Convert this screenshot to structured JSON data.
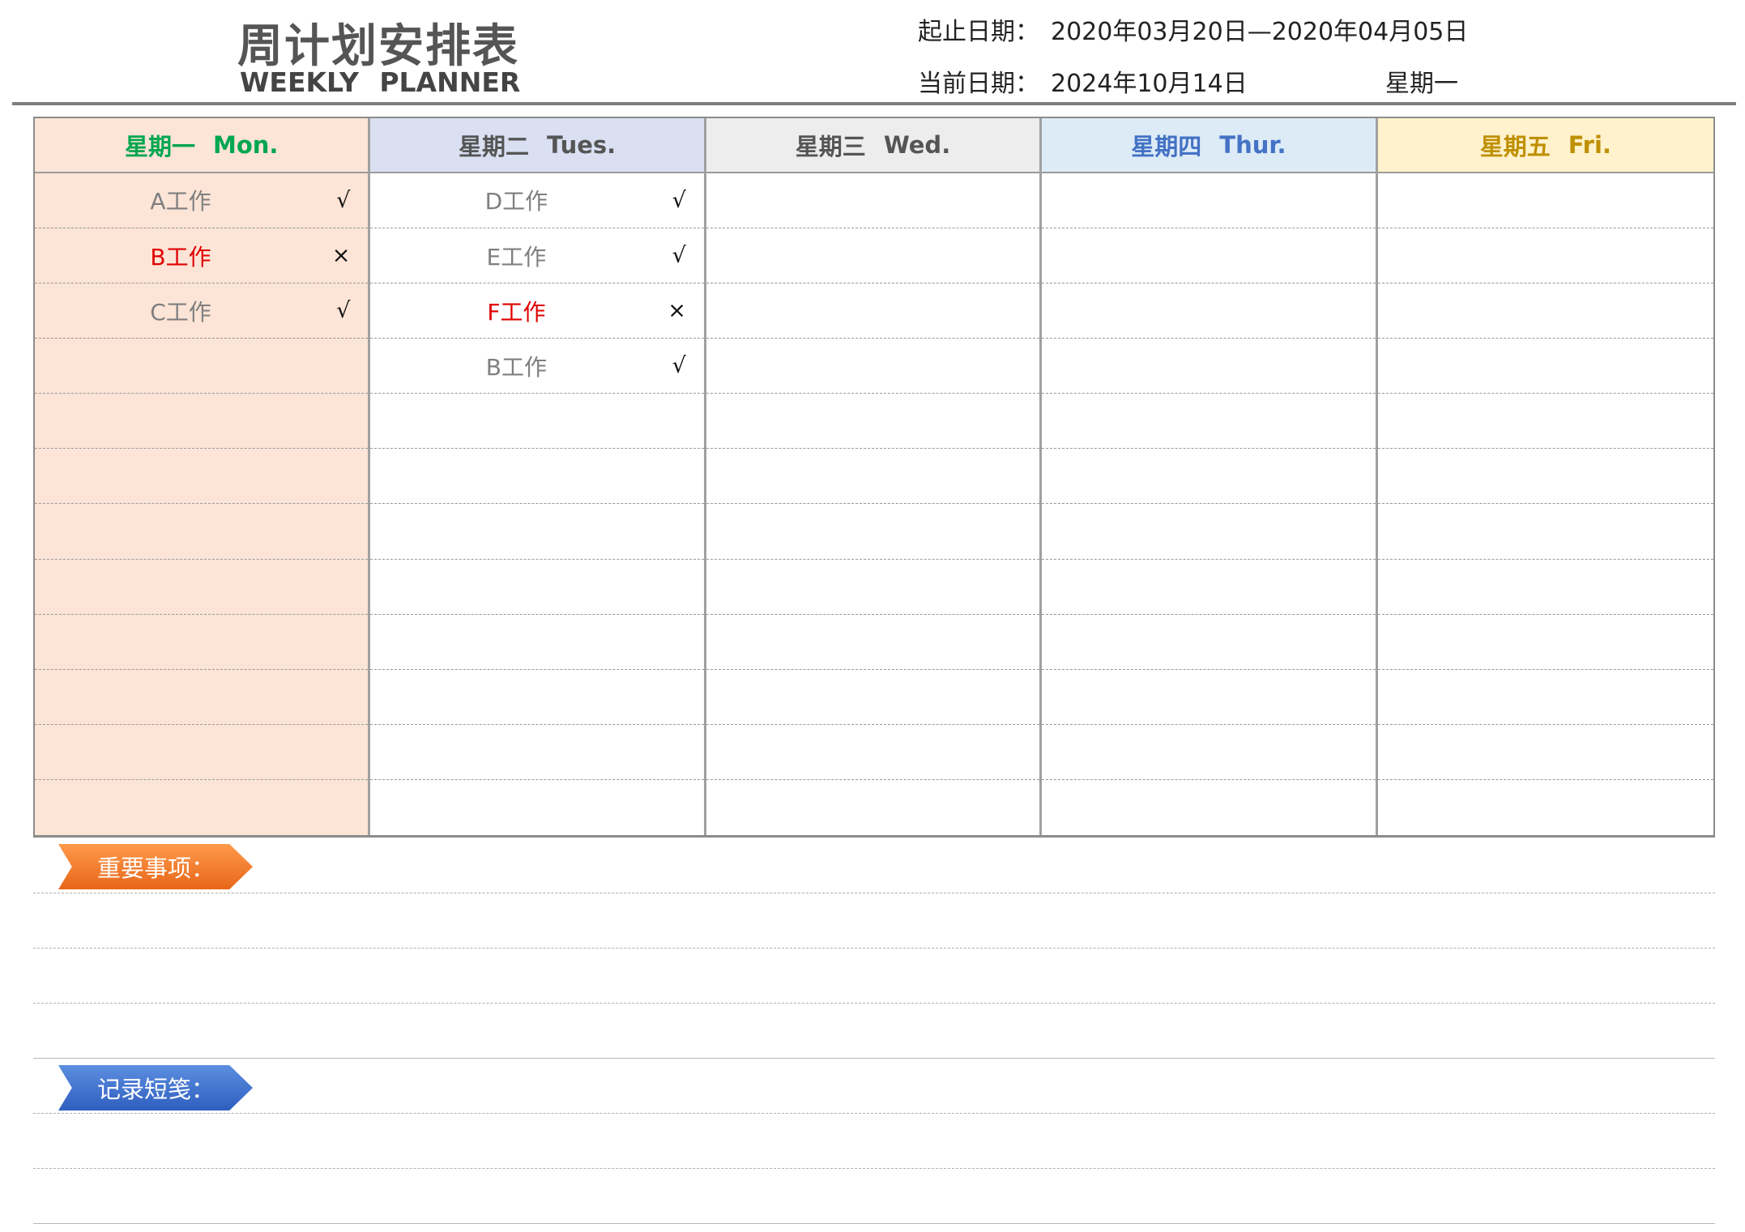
{
  "header": {
    "title_zh": "周计划安排表",
    "title_en": "WEEKLY   PLANNER",
    "range_label": "起止日期：",
    "range_value": "2020年03月20日—2020年04月05日",
    "current_label": "当前日期：",
    "current_value": "2024年10月14日",
    "weekday": "星期一"
  },
  "days": [
    {
      "zh": "星期一",
      "en": "Mon.",
      "color": "#00a651",
      "bg": "#fce4d6",
      "tasks": [
        {
          "text": "A工作",
          "mark": "√",
          "color": "#7f7f7f"
        },
        {
          "text": "B工作",
          "mark": "×",
          "color": "#e00000"
        },
        {
          "text": "C工作",
          "mark": "√",
          "color": "#7f7f7f"
        }
      ]
    },
    {
      "zh": "星期二",
      "en": "Tues.",
      "color": "#555555",
      "bg": "#dae0f2",
      "tasks": [
        {
          "text": "D工作",
          "mark": "√",
          "color": "#7f7f7f"
        },
        {
          "text": "E工作",
          "mark": "√",
          "color": "#7f7f7f"
        },
        {
          "text": "F工作",
          "mark": "×",
          "color": "#e00000"
        },
        {
          "text": "B工作",
          "mark": "√",
          "color": "#7f7f7f"
        }
      ]
    },
    {
      "zh": "星期三",
      "en": "Wed.",
      "color": "#555555",
      "bg": "#ededed",
      "tasks": []
    },
    {
      "zh": "星期四",
      "en": "Thur.",
      "color": "#4472c4",
      "bg": "#ddebf7",
      "tasks": []
    },
    {
      "zh": "星期五",
      "en": "Fri.",
      "color": "#bf9000",
      "bg": "#fff2cc",
      "tasks": []
    }
  ],
  "sections": {
    "important": "重要事项：",
    "notes": "记录短笺："
  },
  "colors": {
    "important_bg": "#f07d2e",
    "notes_bg": "#3f6fcf"
  }
}
